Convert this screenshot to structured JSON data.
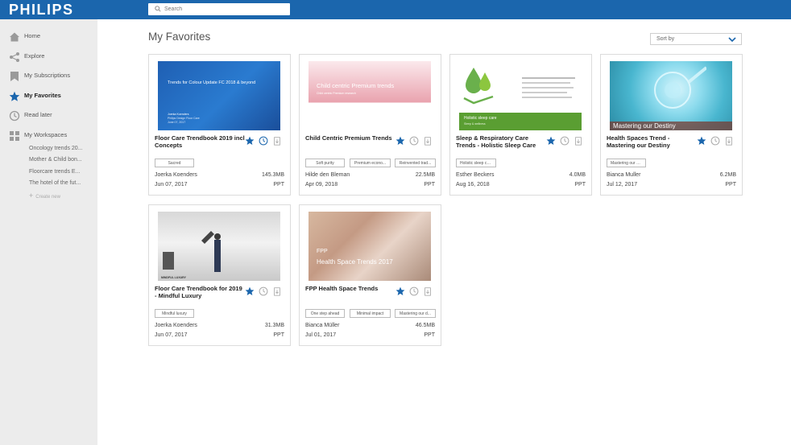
{
  "header": {
    "logo": "PHILIPS",
    "search_placeholder": "Search"
  },
  "sidebar": {
    "nav": [
      {
        "label": "Home",
        "icon": "home-icon"
      },
      {
        "label": "Explore",
        "icon": "share-icon"
      },
      {
        "label": "My Subscriptions",
        "icon": "bookmark-icon"
      },
      {
        "label": "My Favorites",
        "icon": "star-icon"
      },
      {
        "label": "Read later",
        "icon": "clock-icon"
      },
      {
        "label": "My Workspaces",
        "icon": "grid-icon"
      }
    ],
    "workspaces": [
      "Oncology trends 20...",
      "Mother & Child bon...",
      "Floorcare trends E...",
      "The hotel of the fut..."
    ],
    "create_new": "Create new"
  },
  "main": {
    "title": "My Favorites",
    "sort_label": "Sort by"
  },
  "accent": "#1b66ad",
  "cards": [
    {
      "title": "Floor Care Trendbook 2019 incl Concepts",
      "tags": [
        "Sacred"
      ],
      "author": "Joerka Koenders",
      "size": "145.3MB",
      "date": "Jun 07, 2017",
      "type": "PPT",
      "thumb": {
        "text": "Trends for Colour Update FC 2018 & beyond",
        "sub1": "Joerka Koenders",
        "sub2": "Philips Design Floor Care",
        "sub3": "June 07, 2017"
      }
    },
    {
      "title": "Child Centric Premium Trends",
      "tags": [
        "Soft purity",
        "Premium econo...",
        "Reinvented trad..."
      ],
      "author": "Hilde den Bleman",
      "size": "22.5MB",
      "date": "Apr 09, 2018",
      "type": "PPT",
      "thumb": {
        "text": "Child centric Premium trends",
        "sub1": "Child centric Premium research"
      }
    },
    {
      "title": "Sleep & Respiratory Care Trends - Holistic Sleep Care",
      "tags": [
        "Holistic sleep care"
      ],
      "author": "Esther Beckers",
      "size": "4.0MB",
      "date": "Aug 16, 2018",
      "type": "PPT",
      "thumb": {
        "text": "Holistic sleep care",
        "sub1": "Sleep & wellness"
      }
    },
    {
      "title": "Health Spaces Trend - Mastering our Destiny",
      "tags": [
        "Mastering our D..."
      ],
      "author": "Bianca Muller",
      "size": "6.2MB",
      "date": "Jul 12, 2017",
      "type": "PPT",
      "thumb": {
        "text": "Mastering our Destiny"
      }
    },
    {
      "title": "Floor Care Trendbook for 2019 - Mindful Luxury",
      "tags": [
        "Mindful luxury"
      ],
      "author": "Joerka Koenders",
      "size": "31.3MB",
      "date": "Jun 07, 2017",
      "type": "PPT",
      "thumb": {
        "text": "MINDFUL LUXURY"
      }
    },
    {
      "title": "FPP Health Space Trends",
      "tags": [
        "One step ahead",
        "Minimal impact",
        "Mastering our d..."
      ],
      "author": "Bianca Müller",
      "size": "46.5MB",
      "date": "Jul 01, 2017",
      "type": "PPT",
      "thumb": {
        "text": "FPP",
        "sub1": "Health Space Trends 2017"
      }
    }
  ]
}
